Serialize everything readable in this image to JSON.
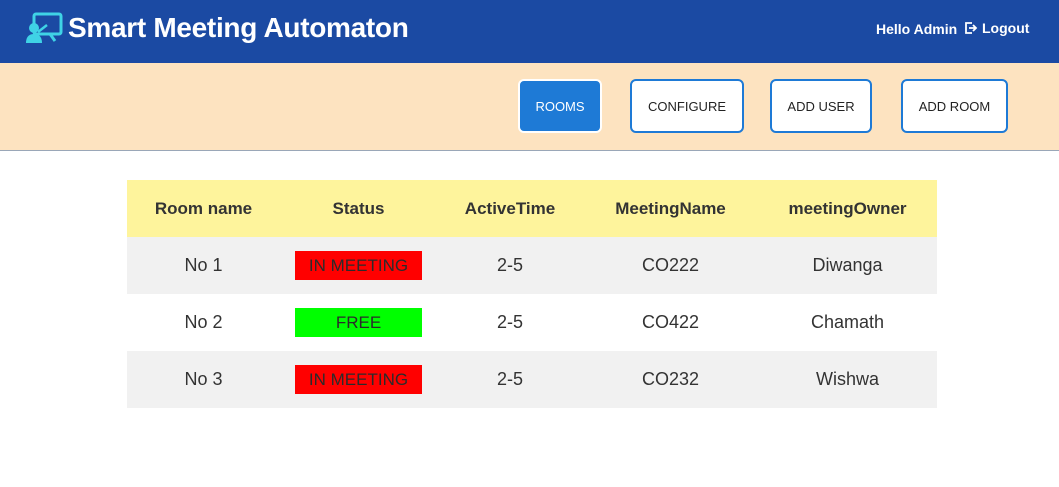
{
  "app": {
    "title": "Smart Meeting Automaton",
    "greeting": "Hello Admin",
    "logout_label": "Logout"
  },
  "nav": {
    "rooms_label": "ROOMS",
    "configure_label": "CONFIGURE",
    "add_user_label": "ADD USER",
    "add_room_label": "ADD ROOM",
    "active_item": "ROOMS"
  },
  "table": {
    "headers": [
      "Room name",
      "Status",
      "ActiveTime",
      "MeetingName",
      "meetingOwner"
    ],
    "rows": [
      {
        "room": "No 1",
        "status": "IN MEETING",
        "active_time": "2-5",
        "meeting": "CO222",
        "owner": "Diwanga"
      },
      {
        "room": "No 2",
        "status": "FREE",
        "active_time": "2-5",
        "meeting": "CO422",
        "owner": "Chamath"
      },
      {
        "room": "No 3",
        "status": "IN MEETING",
        "active_time": "2-5",
        "meeting": "CO232",
        "owner": "Wishwa"
      }
    ]
  },
  "colors": {
    "header_bg": "#1b4aa3",
    "nav_bg": "#fde3c0",
    "accent": "#1e7ad6",
    "table_header_bg": "#fef49c",
    "status_in_meeting": "#ff0000",
    "status_free": "#00ff00"
  },
  "icons": {
    "logo": "presentation-board-icon",
    "logout": "logout-icon"
  }
}
